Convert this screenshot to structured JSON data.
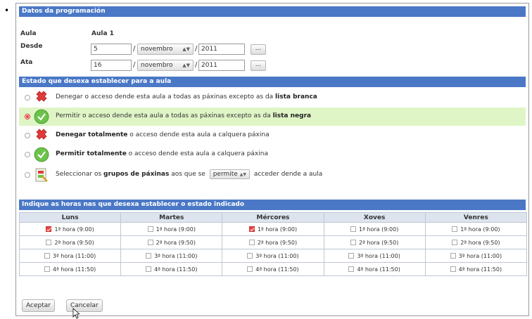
{
  "bullet": "•",
  "header": {
    "title": "Datos da programación"
  },
  "form": {
    "aula_label": "Aula",
    "aula_value": "Aula 1",
    "desde_label": "Desde",
    "desde_day": "5",
    "desde_month": "novembro",
    "desde_year": "2011",
    "ata_label": "Ata",
    "ata_day": "16",
    "ata_month": "novembro",
    "ata_year": "2011",
    "date_sep": "/",
    "calendar_button": "..."
  },
  "estado": {
    "title": "Estado que desexa establecer para a aula",
    "options": [
      {
        "pre": "Denegar o acceso dende esta aula a todas as páxinas excepto as da ",
        "bold": "lista branca",
        "post": "",
        "selected": false,
        "icon": "deny-icon"
      },
      {
        "pre": "Permitir o acceso dende esta aula a todas as páxinas excepto as da ",
        "bold": "lista negra",
        "post": "",
        "selected": true,
        "icon": "allow-icon"
      },
      {
        "pre": "",
        "bold": "Denegar totalmente",
        "post": " o acceso dende esta aula a calquera páxina",
        "selected": false,
        "icon": "deny-icon"
      },
      {
        "pre": "",
        "bold": "Permitir totalmente",
        "post": " o acceso dende esta aula a calquera páxina",
        "selected": false,
        "icon": "allow-icon"
      }
    ],
    "groups_option": {
      "pre": "Seleccionar os ",
      "bold": "grupos de páxinas",
      "mid": " aos que se ",
      "select_value": "permite",
      "post": " acceder dende a aula",
      "selected": false,
      "icon": "page-groups-icon"
    }
  },
  "horas": {
    "title": "Indique as horas nas que desexa establecer o estado indicado",
    "days": [
      "Luns",
      "Martes",
      "Mércores",
      "Xoves",
      "Venres"
    ],
    "slots": [
      "1ª hora (9:00)",
      "2ª hora (9:50)",
      "3ª hora (11:00)",
      "4ª hora (11:50)"
    ],
    "checked": [
      [
        true,
        false,
        true,
        false,
        false
      ],
      [
        false,
        false,
        false,
        false,
        false
      ],
      [
        false,
        false,
        false,
        false,
        false
      ],
      [
        false,
        false,
        false,
        false,
        false
      ]
    ]
  },
  "buttons": {
    "accept": "Aceptar",
    "cancel": "Cancelar"
  },
  "colors": {
    "header_bar": "#4a78c6",
    "selected_row": "#dff5c6",
    "check_red": "#e8443c",
    "allow_green": "#6cc34a",
    "deny_red": "#e03a3a"
  }
}
